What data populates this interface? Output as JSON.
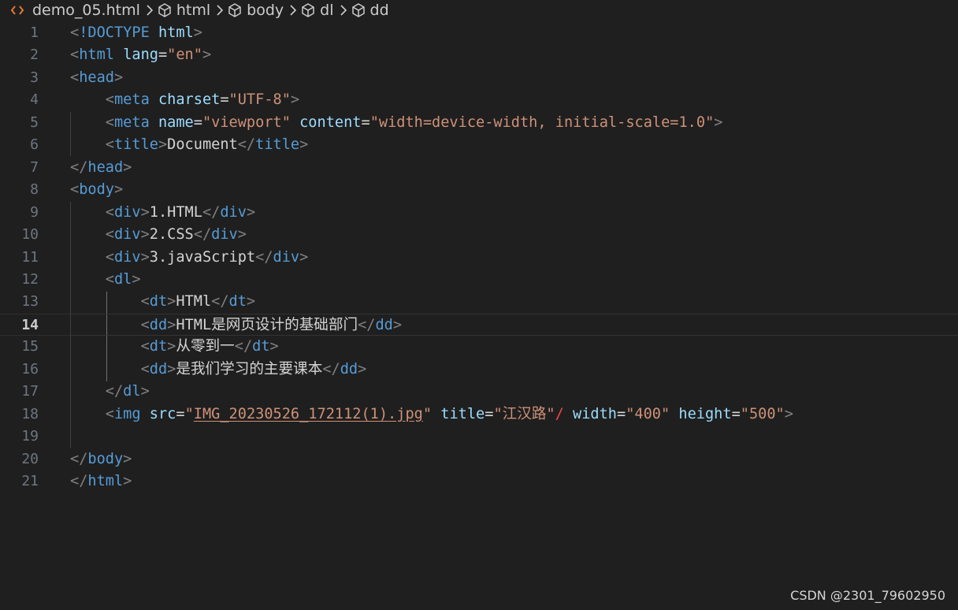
{
  "breadcrumb": {
    "items": [
      {
        "label": "demo_05.html",
        "icon": "html-file-icon"
      },
      {
        "label": "html",
        "icon": "symbol-cube-icon"
      },
      {
        "label": "body",
        "icon": "symbol-cube-icon"
      },
      {
        "label": "dl",
        "icon": "symbol-cube-icon"
      },
      {
        "label": "dd",
        "icon": "symbol-cube-icon"
      }
    ]
  },
  "editor": {
    "current_line": 14,
    "lines": [
      {
        "n": "1",
        "tokens": [
          [
            "punct",
            "<"
          ],
          [
            "doctype",
            "!DOCTYPE"
          ],
          [
            "text",
            " "
          ],
          [
            "attr",
            "html"
          ],
          [
            "punct",
            ">"
          ]
        ]
      },
      {
        "n": "2",
        "tokens": [
          [
            "punct",
            "<"
          ],
          [
            "tag",
            "html"
          ],
          [
            "text",
            " "
          ],
          [
            "attr",
            "lang"
          ],
          [
            "text",
            "="
          ],
          [
            "str",
            "\"en\""
          ],
          [
            "punct",
            ">"
          ]
        ]
      },
      {
        "n": "3",
        "tokens": [
          [
            "punct",
            "<"
          ],
          [
            "tag",
            "head"
          ],
          [
            "punct",
            ">"
          ]
        ]
      },
      {
        "n": "4",
        "tokens": [
          [
            "text",
            "    "
          ],
          [
            "punct",
            "<"
          ],
          [
            "tag",
            "meta"
          ],
          [
            "text",
            " "
          ],
          [
            "attr",
            "charset"
          ],
          [
            "text",
            "="
          ],
          [
            "str",
            "\"UTF-8\""
          ],
          [
            "punct",
            ">"
          ]
        ]
      },
      {
        "n": "5",
        "tokens": [
          [
            "text",
            "    "
          ],
          [
            "punct",
            "<"
          ],
          [
            "tag",
            "meta"
          ],
          [
            "text",
            " "
          ],
          [
            "attr",
            "name"
          ],
          [
            "text",
            "="
          ],
          [
            "str",
            "\"viewport\""
          ],
          [
            "text",
            " "
          ],
          [
            "attr",
            "content"
          ],
          [
            "text",
            "="
          ],
          [
            "str",
            "\"width=device-width, initial-scale=1.0\""
          ],
          [
            "punct",
            ">"
          ]
        ]
      },
      {
        "n": "6",
        "tokens": [
          [
            "text",
            "    "
          ],
          [
            "punct",
            "<"
          ],
          [
            "tag",
            "title"
          ],
          [
            "punct",
            ">"
          ],
          [
            "text",
            "Document"
          ],
          [
            "punct",
            "</"
          ],
          [
            "tag",
            "title"
          ],
          [
            "punct",
            ">"
          ]
        ]
      },
      {
        "n": "7",
        "tokens": [
          [
            "punct",
            "</"
          ],
          [
            "tag",
            "head"
          ],
          [
            "punct",
            ">"
          ]
        ]
      },
      {
        "n": "8",
        "tokens": [
          [
            "punct",
            "<"
          ],
          [
            "tag",
            "body"
          ],
          [
            "punct",
            ">"
          ]
        ]
      },
      {
        "n": "9",
        "tokens": [
          [
            "text",
            "    "
          ],
          [
            "punct",
            "<"
          ],
          [
            "tag",
            "div"
          ],
          [
            "punct",
            ">"
          ],
          [
            "text",
            "1.HTML"
          ],
          [
            "punct",
            "</"
          ],
          [
            "tag",
            "div"
          ],
          [
            "punct",
            ">"
          ]
        ]
      },
      {
        "n": "10",
        "tokens": [
          [
            "text",
            "    "
          ],
          [
            "punct",
            "<"
          ],
          [
            "tag",
            "div"
          ],
          [
            "punct",
            ">"
          ],
          [
            "text",
            "2.CSS"
          ],
          [
            "punct",
            "</"
          ],
          [
            "tag",
            "div"
          ],
          [
            "punct",
            ">"
          ]
        ]
      },
      {
        "n": "11",
        "tokens": [
          [
            "text",
            "    "
          ],
          [
            "punct",
            "<"
          ],
          [
            "tag",
            "div"
          ],
          [
            "punct",
            ">"
          ],
          [
            "text",
            "3.javaScript"
          ],
          [
            "punct",
            "</"
          ],
          [
            "tag",
            "div"
          ],
          [
            "punct",
            ">"
          ]
        ]
      },
      {
        "n": "12",
        "tokens": [
          [
            "text",
            "    "
          ],
          [
            "punct",
            "<"
          ],
          [
            "tag",
            "dl"
          ],
          [
            "punct",
            ">"
          ]
        ]
      },
      {
        "n": "13",
        "tokens": [
          [
            "text",
            "        "
          ],
          [
            "punct",
            "<"
          ],
          [
            "tag",
            "dt"
          ],
          [
            "punct",
            ">"
          ],
          [
            "text",
            "HTMl"
          ],
          [
            "punct",
            "</"
          ],
          [
            "tag",
            "dt"
          ],
          [
            "punct",
            ">"
          ]
        ]
      },
      {
        "n": "14",
        "tokens": [
          [
            "text",
            "        "
          ],
          [
            "punct",
            "<"
          ],
          [
            "tag",
            "dd"
          ],
          [
            "punct",
            ">"
          ],
          [
            "text",
            "HTML是网页设计的基础部门"
          ],
          [
            "punct",
            "</"
          ],
          [
            "tag",
            "dd"
          ],
          [
            "punct",
            ">"
          ]
        ]
      },
      {
        "n": "15",
        "tokens": [
          [
            "text",
            "        "
          ],
          [
            "punct",
            "<"
          ],
          [
            "tag",
            "dt"
          ],
          [
            "punct",
            ">"
          ],
          [
            "text",
            "从零到一"
          ],
          [
            "punct",
            "</"
          ],
          [
            "tag",
            "dt"
          ],
          [
            "punct",
            ">"
          ]
        ]
      },
      {
        "n": "16",
        "tokens": [
          [
            "text",
            "        "
          ],
          [
            "punct",
            "<"
          ],
          [
            "tag",
            "dd"
          ],
          [
            "punct",
            ">"
          ],
          [
            "text",
            "是我们学习的主要课本"
          ],
          [
            "punct",
            "</"
          ],
          [
            "tag",
            "dd"
          ],
          [
            "punct",
            ">"
          ]
        ]
      },
      {
        "n": "17",
        "tokens": [
          [
            "text",
            "    "
          ],
          [
            "punct",
            "</"
          ],
          [
            "tag",
            "dl"
          ],
          [
            "punct",
            ">"
          ]
        ]
      },
      {
        "n": "18",
        "tokens": [
          [
            "text",
            "    "
          ],
          [
            "punct",
            "<"
          ],
          [
            "tag",
            "img"
          ],
          [
            "text",
            " "
          ],
          [
            "attr",
            "src"
          ],
          [
            "text",
            "="
          ],
          [
            "str",
            "\""
          ],
          [
            "strlink",
            "IMG_20230526_172112(1).jpg"
          ],
          [
            "str",
            "\""
          ],
          [
            "text",
            " "
          ],
          [
            "attr",
            "title"
          ],
          [
            "text",
            "="
          ],
          [
            "str",
            "\"江汉路\""
          ],
          [
            "error",
            "/"
          ],
          [
            "text",
            " "
          ],
          [
            "attr",
            "width"
          ],
          [
            "text",
            "="
          ],
          [
            "str",
            "\"400\""
          ],
          [
            "text",
            " "
          ],
          [
            "attr",
            "height"
          ],
          [
            "text",
            "="
          ],
          [
            "str",
            "\"500\""
          ],
          [
            "punct",
            ">"
          ]
        ]
      },
      {
        "n": "19",
        "tokens": []
      },
      {
        "n": "20",
        "tokens": [
          [
            "punct",
            "</"
          ],
          [
            "tag",
            "body"
          ],
          [
            "punct",
            ">"
          ]
        ]
      },
      {
        "n": "21",
        "tokens": [
          [
            "punct",
            "</"
          ],
          [
            "tag",
            "html"
          ],
          [
            "punct",
            ">"
          ]
        ]
      }
    ]
  },
  "watermark": "CSDN @2301_79602950",
  "colors": {
    "background": "#1f1f1f",
    "tag": "#569cd6",
    "attribute": "#9cdcfe",
    "string": "#ce9178",
    "punctuation": "#808080",
    "text": "#d4d4d4",
    "line_number": "#6e7681",
    "file_icon": "#e37933"
  }
}
